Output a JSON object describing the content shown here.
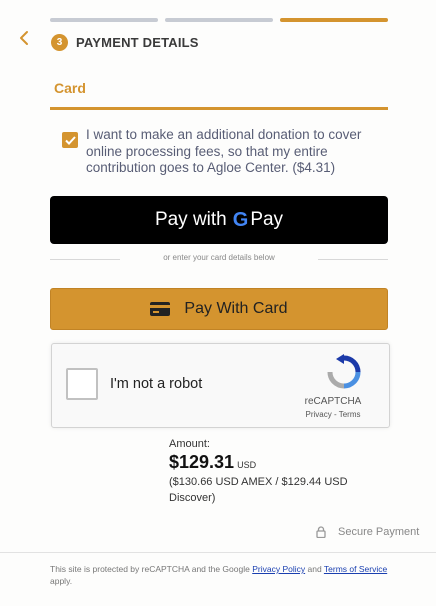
{
  "progress": {
    "total_steps": 3,
    "current_step": 3
  },
  "header": {
    "step_number": "3",
    "title": "PAYMENT DETAILS"
  },
  "tabs": {
    "card_label": "Card"
  },
  "donation": {
    "checked": true,
    "text": "I want to make an additional donation to cover online processing fees, so that my entire contribution goes to Agloe Center. ($4.31)"
  },
  "gpay": {
    "prefix": "Pay with",
    "g": "G",
    "suffix": "Pay"
  },
  "divider_text": "or enter your card details below",
  "pay_card": {
    "label": "Pay With Card",
    "icon": "credit-card-icon"
  },
  "recaptcha": {
    "label": "I'm not a robot",
    "brand": "reCAPTCHA",
    "privacy": "Privacy",
    "separator": " - ",
    "terms": "Terms"
  },
  "amount": {
    "label": "Amount:",
    "value": "$129.31",
    "currency": "USD",
    "alt": "($130.66 USD AMEX / $129.44 USD Discover)"
  },
  "secure": {
    "label": "Secure Payment",
    "icon": "lock-icon"
  },
  "footer": {
    "prefix": "This site is protected by reCAPTCHA and the Google ",
    "privacy_link": "Privacy Policy",
    "middle": " and ",
    "terms_link": "Terms of Service",
    "suffix": " apply."
  },
  "colors": {
    "accent": "#d4942f",
    "inactive": "#c7cbd3",
    "gpay_bg": "#000000",
    "link": "#1a3fb0"
  }
}
